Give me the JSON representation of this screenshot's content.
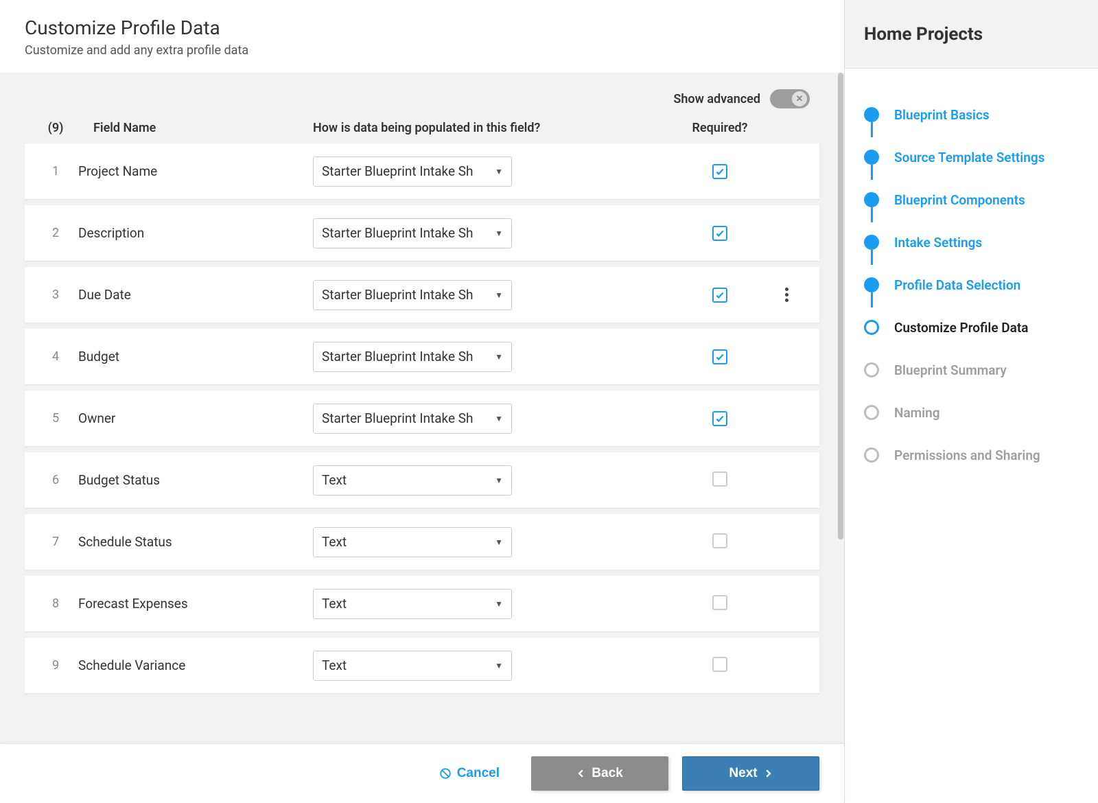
{
  "header": {
    "title": "Customize Profile Data",
    "subtitle": "Customize and add any extra profile data"
  },
  "advanced": {
    "label": "Show advanced",
    "knob": "✕"
  },
  "columns": {
    "count": "(9)",
    "name": "Field Name",
    "pop": "How is data being populated in this field?",
    "req": "Required?"
  },
  "rows": [
    {
      "num": "1",
      "name": "Project Name",
      "pop": "Starter Blueprint Intake Sh",
      "required": true,
      "kebab": false
    },
    {
      "num": "2",
      "name": "Description",
      "pop": "Starter Blueprint Intake Sh",
      "required": true,
      "kebab": false
    },
    {
      "num": "3",
      "name": "Due Date",
      "pop": "Starter Blueprint Intake Sh",
      "required": true,
      "kebab": true
    },
    {
      "num": "4",
      "name": "Budget",
      "pop": "Starter Blueprint Intake Sh",
      "required": true,
      "kebab": false
    },
    {
      "num": "5",
      "name": "Owner",
      "pop": "Starter Blueprint Intake Sh",
      "required": true,
      "kebab": false
    },
    {
      "num": "6",
      "name": "Budget Status",
      "pop": "Text",
      "required": false,
      "kebab": false
    },
    {
      "num": "7",
      "name": "Schedule Status",
      "pop": "Text",
      "required": false,
      "kebab": false
    },
    {
      "num": "8",
      "name": "Forecast Expenses",
      "pop": "Text",
      "required": false,
      "kebab": false
    },
    {
      "num": "9",
      "name": "Schedule Variance",
      "pop": "Text",
      "required": false,
      "kebab": false
    }
  ],
  "footer": {
    "cancel": "Cancel",
    "back": "Back",
    "next": "Next"
  },
  "sidebar": {
    "title": "Home Projects",
    "steps": [
      {
        "label": "Blueprint Basics",
        "state": "done"
      },
      {
        "label": "Source Template Settings",
        "state": "done"
      },
      {
        "label": "Blueprint Components",
        "state": "done"
      },
      {
        "label": "Intake Settings",
        "state": "done"
      },
      {
        "label": "Profile Data Selection",
        "state": "done"
      },
      {
        "label": "Customize Profile Data",
        "state": "current"
      },
      {
        "label": "Blueprint Summary",
        "state": "future"
      },
      {
        "label": "Naming",
        "state": "future"
      },
      {
        "label": "Permissions and Sharing",
        "state": "future"
      }
    ]
  }
}
